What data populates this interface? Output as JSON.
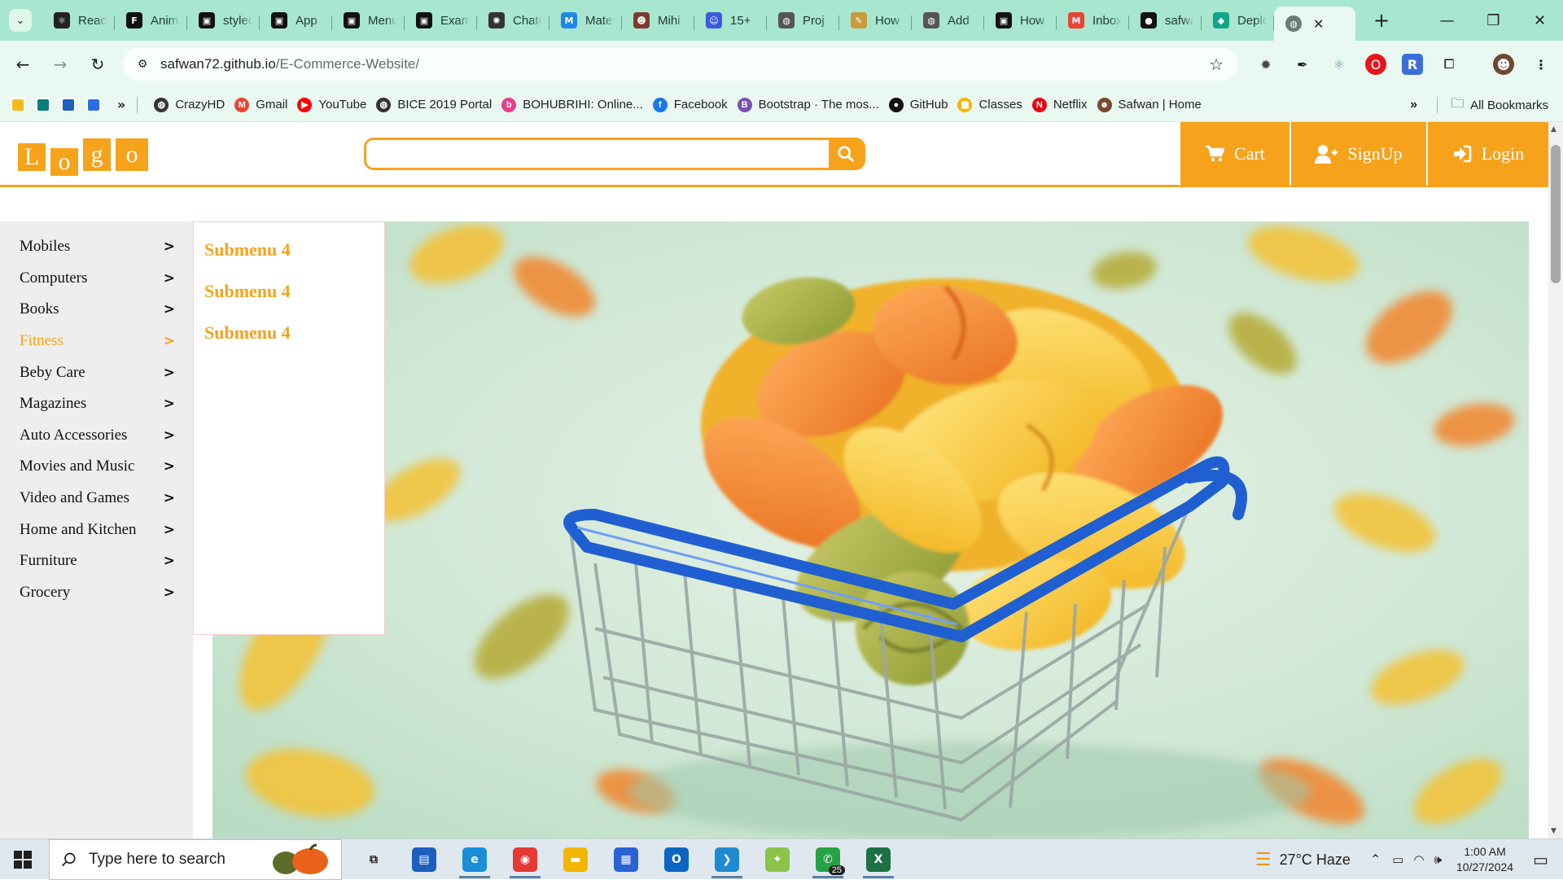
{
  "browser": {
    "tabs": [
      {
        "title": "React",
        "icon": "react-icon",
        "color": "#222222",
        "glyph": "⚛"
      },
      {
        "title": "Animations",
        "icon": "framer-icon",
        "color": "#111111",
        "glyph": "F"
      },
      {
        "title": "styled",
        "icon": "square-icon",
        "color": "#111111",
        "glyph": "▣"
      },
      {
        "title": "App",
        "icon": "square-icon",
        "color": "#111111",
        "glyph": "▣"
      },
      {
        "title": "Menu",
        "icon": "square-icon",
        "color": "#111111",
        "glyph": "▣"
      },
      {
        "title": "Example",
        "icon": "square-icon",
        "color": "#111111",
        "glyph": "▣"
      },
      {
        "title": "ChatGPT",
        "icon": "chatgpt-icon",
        "color": "#333333",
        "glyph": "✺"
      },
      {
        "title": "Material",
        "icon": "mui-icon",
        "color": "#1e88e5",
        "glyph": "M"
      },
      {
        "title": "Mihi",
        "icon": "avatar-icon",
        "color": "#7a3b2e",
        "glyph": "☻"
      },
      {
        "title": "15+",
        "icon": "people-icon",
        "color": "#3b5bdb",
        "glyph": "☺"
      },
      {
        "title": "Proj",
        "icon": "globe-icon",
        "color": "#555555",
        "glyph": "◍"
      },
      {
        "title": "How",
        "icon": "pencil-icon",
        "color": "#c79a3b",
        "glyph": "✎"
      },
      {
        "title": "Add",
        "icon": "globe-icon",
        "color": "#555555",
        "glyph": "◍"
      },
      {
        "title": "How",
        "icon": "square-icon",
        "color": "#111111",
        "glyph": "▣"
      },
      {
        "title": "Inbox",
        "icon": "gmail-icon",
        "color": "#ea4335",
        "glyph": "M"
      },
      {
        "title": "safwan",
        "icon": "github-icon",
        "color": "#111111",
        "glyph": "●"
      },
      {
        "title": "Deploy",
        "icon": "diamond-icon",
        "color": "#14a38b",
        "glyph": "◆"
      }
    ],
    "active_tab": {
      "title": "",
      "icon": "globe-icon"
    },
    "new_tab_label": "+",
    "url_host": "safwan72.github.io",
    "url_path": "/E-Commerce-Website/",
    "bookmarks": [
      {
        "label": "CrazyHD",
        "icon": "globe-icon",
        "color": "#333333",
        "glyph": "◍"
      },
      {
        "label": "Gmail",
        "icon": "gmail-icon",
        "color": "#ea4335",
        "glyph": "M"
      },
      {
        "label": "YouTube",
        "icon": "youtube-icon",
        "color": "#ff0000",
        "glyph": "▶"
      },
      {
        "label": "BICE 2019 Portal",
        "icon": "globe-icon",
        "color": "#333333",
        "glyph": "◍"
      },
      {
        "label": "BOHUBRIHI: Online...",
        "icon": "bohubrihi-icon",
        "color": "#e83e8c",
        "glyph": "b"
      },
      {
        "label": "Facebook",
        "icon": "facebook-icon",
        "color": "#1877f2",
        "glyph": "f"
      },
      {
        "label": "Bootstrap · The mos...",
        "icon": "bootstrap-icon",
        "color": "#7952b3",
        "glyph": "B"
      },
      {
        "label": "GitHub",
        "icon": "github-icon",
        "color": "#111111",
        "glyph": "●"
      },
      {
        "label": "Classes",
        "icon": "classroom-icon",
        "color": "#f2b600",
        "glyph": "▦"
      },
      {
        "label": "Netflix",
        "icon": "netflix-icon",
        "color": "#e50914",
        "glyph": "N"
      },
      {
        "label": "Safwan | Home",
        "icon": "avatar-icon",
        "color": "#7a4a2e",
        "glyph": "☻"
      }
    ],
    "all_bookmarks_label": "All Bookmarks"
  },
  "site": {
    "logo_letters": [
      "L",
      "o",
      "g",
      "o"
    ],
    "search": {
      "placeholder": "",
      "value": ""
    },
    "nav": {
      "cart": "Cart",
      "signup": "SignUp",
      "login": "Login"
    },
    "accent": "#f7a21b",
    "categories": [
      {
        "label": "Mobiles",
        "arrow": ">",
        "active": false
      },
      {
        "label": "Computers",
        "arrow": ">",
        "active": false
      },
      {
        "label": "Books",
        "arrow": ">",
        "active": false
      },
      {
        "label": "Fitness",
        "arrow": ">",
        "active": true
      },
      {
        "label": "Beby Care",
        "arrow": ">",
        "active": false
      },
      {
        "label": "Magazines",
        "arrow": ">",
        "active": false
      },
      {
        "label": "Auto Accessories",
        "arrow": ">",
        "active": false
      },
      {
        "label": "Movies and Music",
        "arrow": ">",
        "active": false
      },
      {
        "label": "Video and Games",
        "arrow": ">",
        "active": false
      },
      {
        "label": "Home and Kitchen",
        "arrow": ">",
        "active": false
      },
      {
        "label": "Furniture",
        "arrow": ">",
        "active": false
      },
      {
        "label": "Grocery",
        "arrow": ">",
        "active": false
      }
    ],
    "submenu": [
      "Submenu 4",
      "Submenu 4",
      "Submenu 4"
    ]
  },
  "taskbar": {
    "search_placeholder": "Type here to search",
    "weather": "27°C  Haze",
    "time": "1:00 AM",
    "date": "10/27/2024",
    "whatsapp_badge": "25",
    "apps": [
      {
        "name": "task-view",
        "glyph": "⧉",
        "color": "#1f1f1f",
        "running": false
      },
      {
        "name": "remote-desktop",
        "glyph": "▤",
        "color": "#1d5fbf",
        "running": false
      },
      {
        "name": "edge",
        "glyph": "e",
        "color": "#1a8fd8",
        "running": true
      },
      {
        "name": "chrome",
        "glyph": "◉",
        "color": "#e53935",
        "running": true
      },
      {
        "name": "file-explorer",
        "glyph": "▬",
        "color": "#f2b600",
        "running": false
      },
      {
        "name": "store",
        "glyph": "▦",
        "color": "#2a62d6",
        "running": false
      },
      {
        "name": "outlook",
        "glyph": "O",
        "color": "#0a66c2",
        "running": false
      },
      {
        "name": "vscode",
        "glyph": "❯",
        "color": "#1f8ad2",
        "running": true
      },
      {
        "name": "figma-tool",
        "glyph": "✦",
        "color": "#8bc34a",
        "running": false
      },
      {
        "name": "whatsapp",
        "glyph": "✆",
        "color": "#25a244",
        "running": true
      },
      {
        "name": "excel",
        "glyph": "X",
        "color": "#1e7145",
        "running": true
      }
    ]
  }
}
